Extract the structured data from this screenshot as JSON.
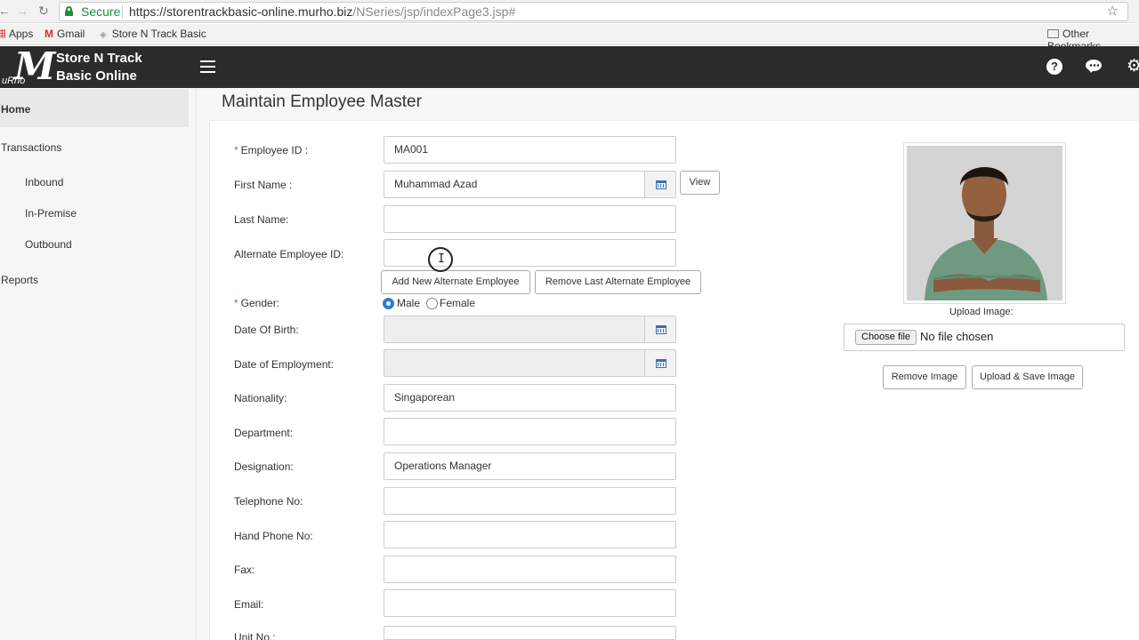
{
  "browser": {
    "secure_label": "Secure",
    "url_host": "https://storentrackbasic-online.murho.biz",
    "url_path": "/NSeries/jsp/indexPage3.jsp#",
    "nav_icons": [
      "back-arrow-icon",
      "forward-arrow-icon",
      "reload-icon",
      "star-icon"
    ],
    "bookmarks": {
      "apps": "Apps",
      "gmail": "Gmail",
      "site": "Store N Track Basic",
      "other": "Other Bookmarks"
    }
  },
  "app": {
    "logo_text": "uRho",
    "brand": "Store N Track Basic Online",
    "header_icons": [
      "help-icon",
      "chat-icon",
      "gear-icon"
    ],
    "header_color": "#2b2b2b"
  },
  "sidebar": {
    "home": "Home",
    "transactions": "Transactions",
    "inbound": "Inbound",
    "in_premise": "In-Premise",
    "outbound": "Outbound",
    "reports": "Reports"
  },
  "page": {
    "title": "Maintain Employee Master"
  },
  "form": {
    "employee_id": {
      "label": "Employee ID :",
      "value": "MA001",
      "required": true
    },
    "first_name": {
      "label": "First Name :",
      "value": "Muhammad Azad"
    },
    "view_button": "View",
    "last_name": {
      "label": "Last Name:",
      "value": ""
    },
    "alt_employee_id": {
      "label": "Alternate Employee ID:",
      "value": ""
    },
    "add_alt_button": "Add New Alternate Employee",
    "remove_alt_button": "Remove Last Alternate Employee",
    "gender": {
      "label": "Gender:",
      "required": true,
      "options": [
        "Male",
        "Female"
      ],
      "selected": "Male"
    },
    "dob": {
      "label": "Date Of Birth:",
      "value": ""
    },
    "doe": {
      "label": "Date of Employment:",
      "value": ""
    },
    "nationality": {
      "label": "Nationality:",
      "value": "Singaporean"
    },
    "department": {
      "label": "Department:",
      "value": ""
    },
    "designation": {
      "label": "Designation:",
      "value": "Operations Manager"
    },
    "telephone": {
      "label": "Telephone No:",
      "value": ""
    },
    "handphone": {
      "label": "Hand Phone No:",
      "value": ""
    },
    "fax": {
      "label": "Fax:",
      "value": ""
    },
    "email": {
      "label": "Email:",
      "value": ""
    },
    "unit_no": {
      "label": "Unit No.:",
      "value": ""
    }
  },
  "image_panel": {
    "upload_label": "Upload Image:",
    "choose_file": "Choose file",
    "no_file": "No file chosen",
    "remove_button": "Remove Image",
    "upload_button": "Upload & Save Image"
  },
  "colors": {
    "required_star": "#d9534f",
    "radio_selected": "#2b7bd9",
    "secure_green": "#1e8e3e"
  }
}
